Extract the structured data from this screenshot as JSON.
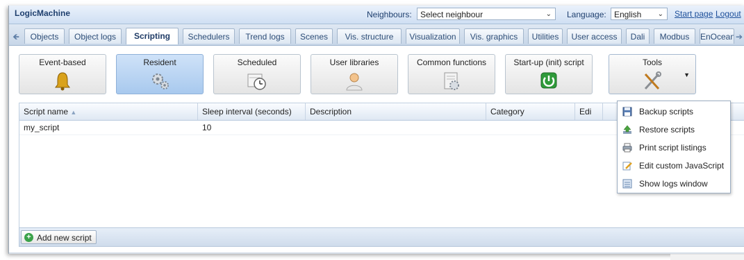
{
  "header": {
    "brand": "LogicMachine",
    "neighbours_label": "Neighbours:",
    "neighbours_value": "Select neighbour",
    "language_label": "Language:",
    "language_value": "English",
    "start_page": "Start page",
    "logout": "Logout"
  },
  "tabs": [
    {
      "label": "Objects"
    },
    {
      "label": "Object logs"
    },
    {
      "label": "Scripting"
    },
    {
      "label": "Schedulers"
    },
    {
      "label": "Trend logs"
    },
    {
      "label": "Scenes"
    },
    {
      "label": "Vis. structure"
    },
    {
      "label": "Visualization"
    },
    {
      "label": "Vis. graphics"
    },
    {
      "label": "Utilities"
    },
    {
      "label": "User access"
    },
    {
      "label": "Dali"
    },
    {
      "label": "Modbus"
    },
    {
      "label": "EnOcean"
    }
  ],
  "active_tab": "Scripting",
  "toolbar": {
    "buttons": [
      {
        "label": "Event-based",
        "icon": "bell-icon"
      },
      {
        "label": "Resident",
        "icon": "gears-icon"
      },
      {
        "label": "Scheduled",
        "icon": "clock-icon"
      },
      {
        "label": "User libraries",
        "icon": "user-icon"
      },
      {
        "label": "Common functions",
        "icon": "document-gear-icon"
      },
      {
        "label": "Start-up (init) script",
        "icon": "power-icon"
      },
      {
        "label": "Tools",
        "icon": "tools-icon"
      }
    ],
    "active_button": "Resident"
  },
  "grid": {
    "columns": [
      "Script name",
      "Sleep interval (seconds)",
      "Description",
      "Category",
      "Edi"
    ],
    "rows": [
      {
        "name": "my_script",
        "sleep": "10",
        "description": "",
        "category": ""
      }
    ]
  },
  "footer": {
    "add_label": "Add new script"
  },
  "tools_menu": [
    {
      "label": "Backup scripts",
      "icon": "floppy-icon"
    },
    {
      "label": "Restore scripts",
      "icon": "upload-icon"
    },
    {
      "label": "Print script listings",
      "icon": "printer-icon"
    },
    {
      "label": "Edit custom JavaScript",
      "icon": "edit-icon"
    },
    {
      "label": "Show logs window",
      "icon": "log-window-icon"
    }
  ],
  "colors": {
    "active_button": "#a8c9ee",
    "header_text": "#1e3f6e",
    "link": "#1d4f9a",
    "power_green": "#2f9a3a"
  }
}
